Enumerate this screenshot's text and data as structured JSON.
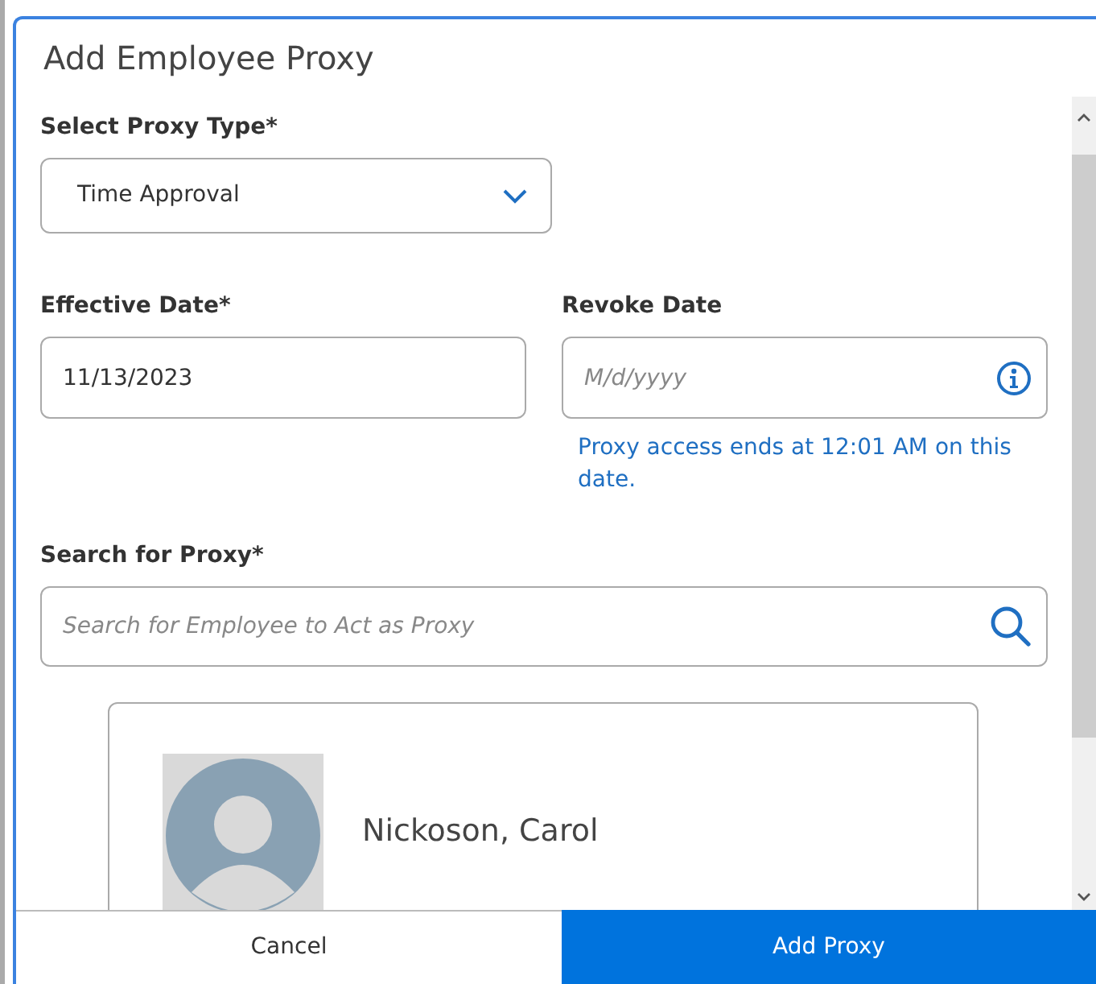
{
  "dialog": {
    "title": "Add Employee Proxy"
  },
  "proxy_type": {
    "label": "Select Proxy Type*",
    "value": "Time Approval"
  },
  "effective_date": {
    "label": "Effective Date*",
    "value": "11/13/2023"
  },
  "revoke_date": {
    "label": "Revoke Date",
    "placeholder": "M/d/yyyy",
    "hint": "Proxy access ends at 12:01 AM on this date."
  },
  "search": {
    "label": "Search for Proxy*",
    "placeholder": "Search for Employee to Act as Proxy"
  },
  "results": [
    {
      "name": "Nickoson, Carol"
    }
  ],
  "buttons": [
    {
      "label": "Cancel",
      "kind": "secondary"
    },
    {
      "label": "Add Proxy",
      "kind": "primary"
    }
  ]
}
